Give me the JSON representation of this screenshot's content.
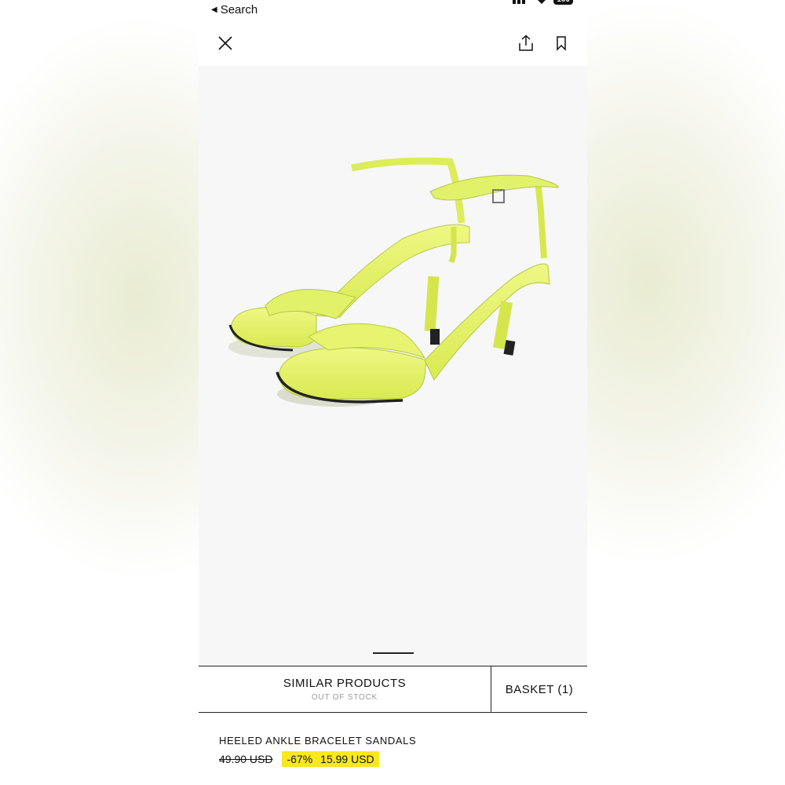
{
  "status_bar": {
    "back_label": "Search",
    "battery": "100"
  },
  "toolbar": {
    "close_icon": "close-icon",
    "share_icon": "share-icon",
    "bookmark_icon": "bookmark-icon"
  },
  "product_image": {
    "subject": "sandals-photo",
    "shoe_color": "#e6f46a"
  },
  "pager": {
    "current": 1
  },
  "actions": {
    "similar_label": "SIMILAR PRODUCTS",
    "similar_sub": "OUT OF STOCK",
    "basket_label": "BASKET (1)"
  },
  "product": {
    "name": "HEELED ANKLE BRACELET SANDALS",
    "old_price": "49.90 USD",
    "discount": "-67%",
    "new_price": "15.99 USD",
    "sale_color": "#f8e81c"
  }
}
